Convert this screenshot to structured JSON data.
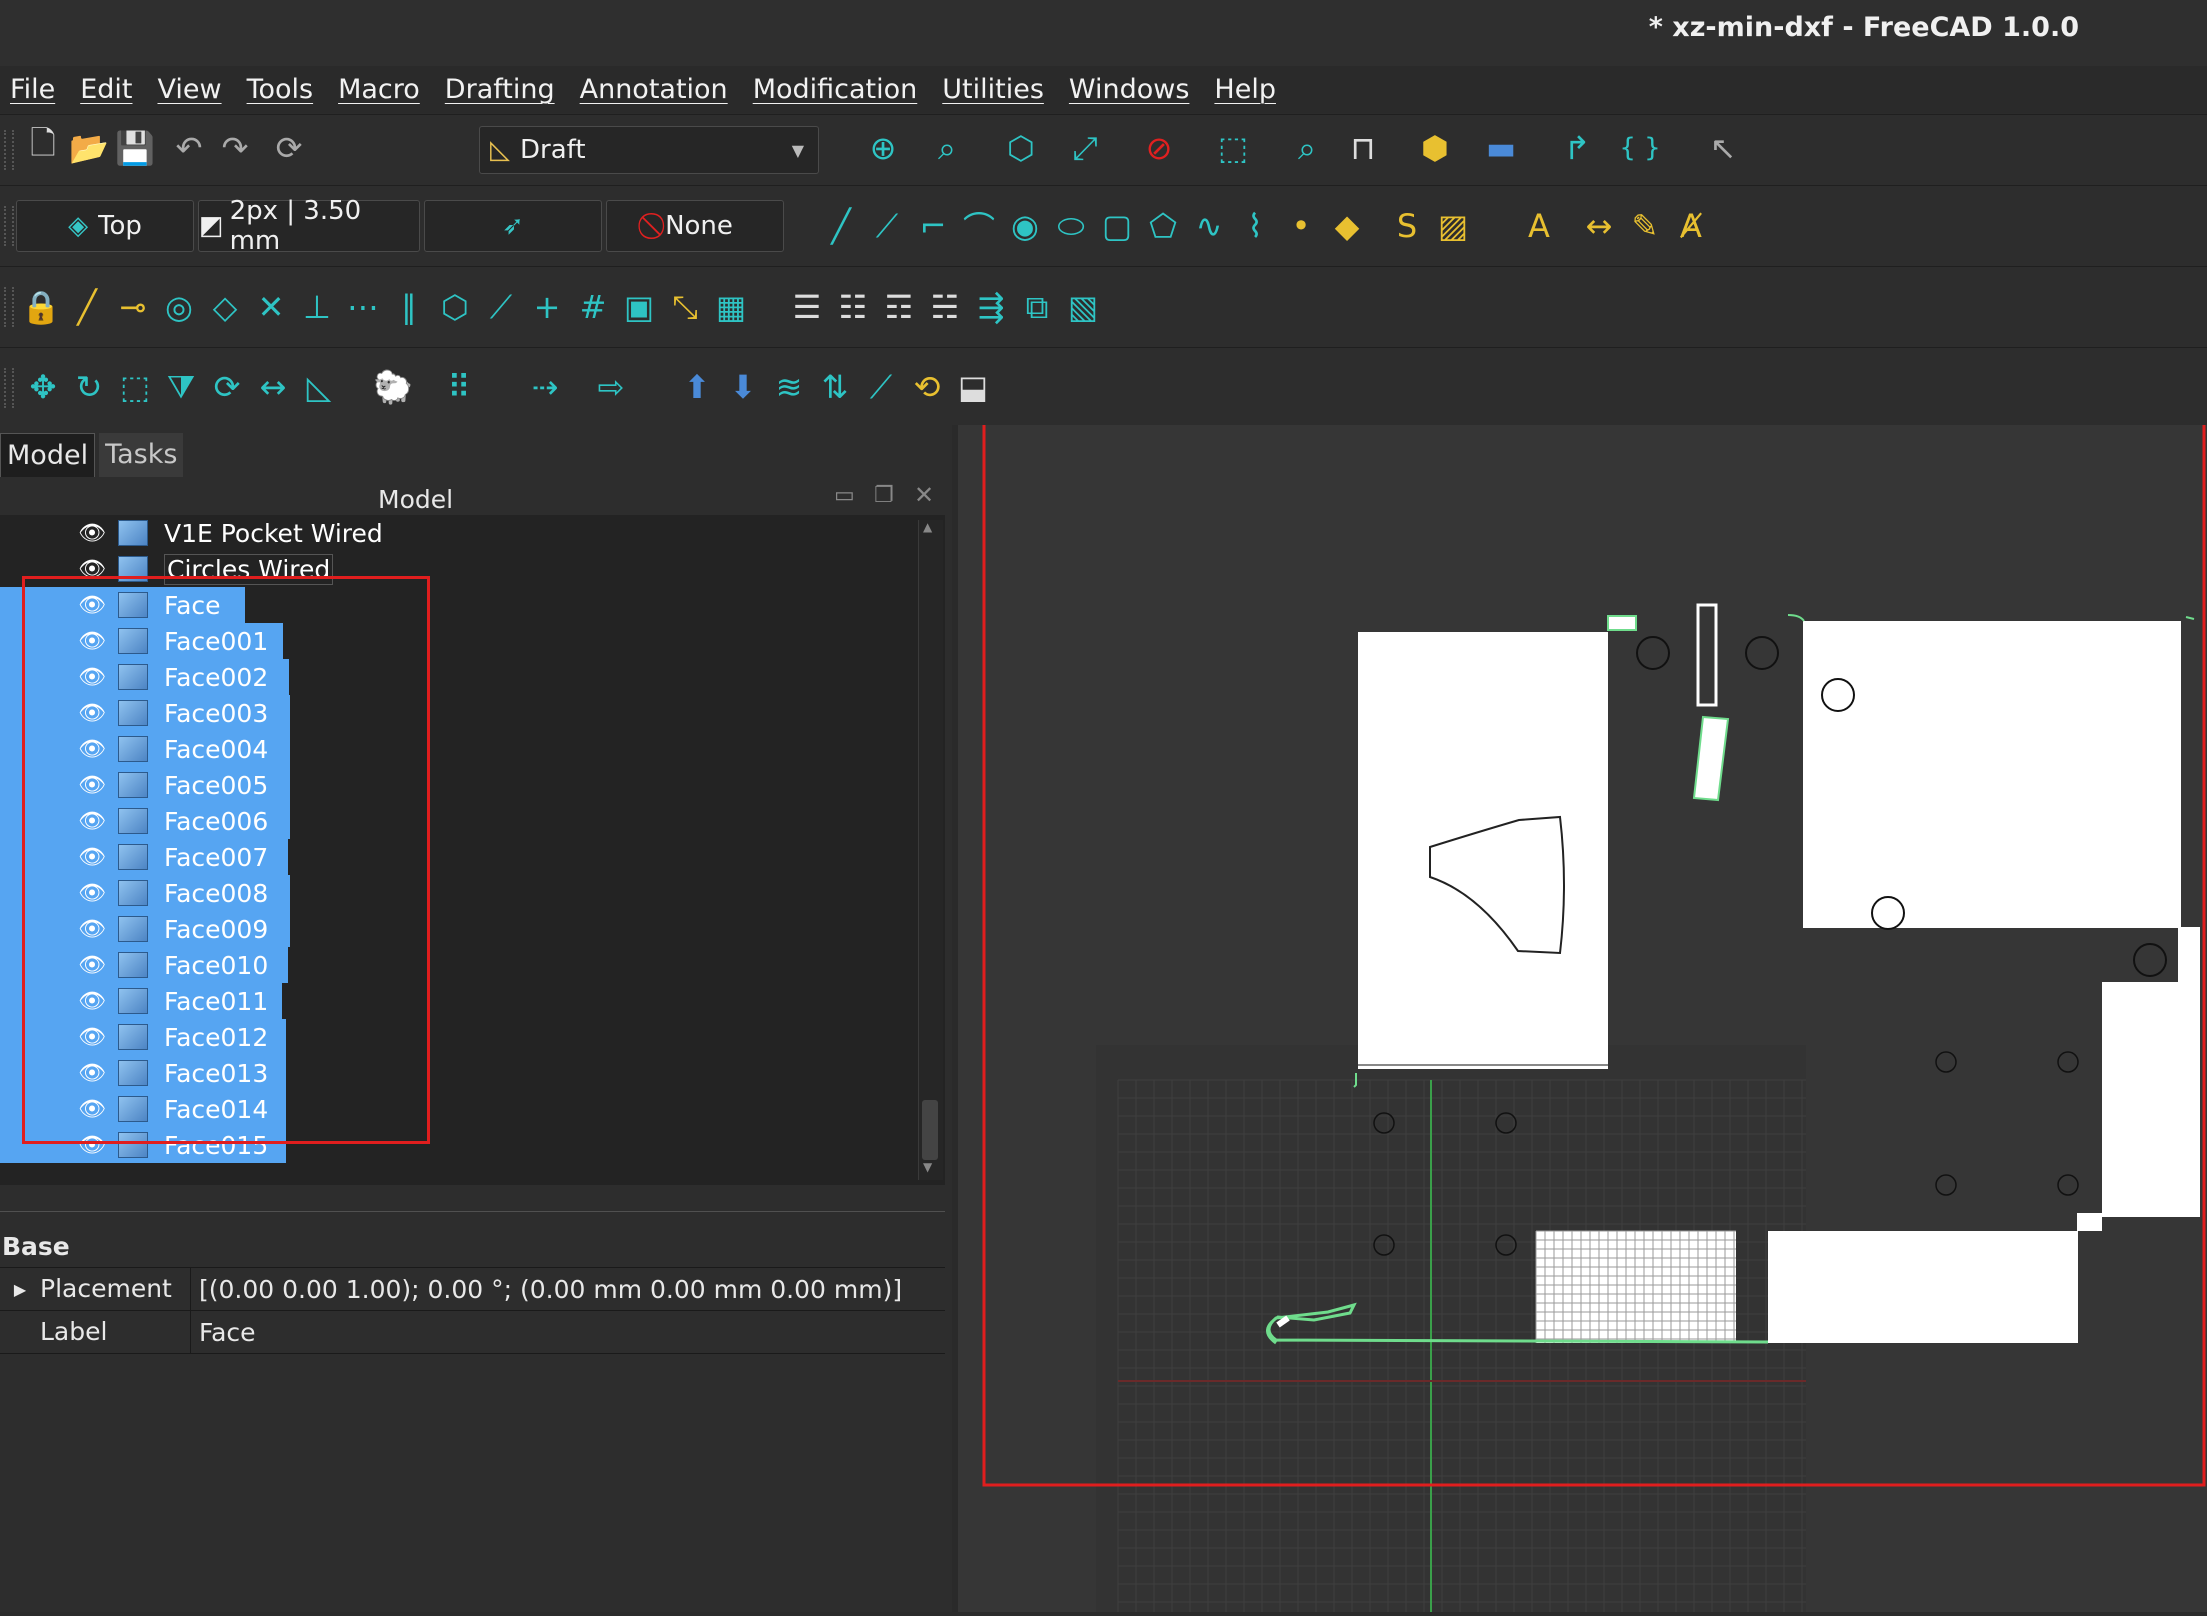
{
  "window": {
    "title": "* xz-min-dxf - FreeCAD 1.0.0"
  },
  "menu": [
    "File",
    "Edit",
    "View",
    "Tools",
    "Macro",
    "Drafting",
    "Annotation",
    "Modification",
    "Utilities",
    "Windows",
    "Help"
  ],
  "toolbar1": {
    "workbench": "Draft"
  },
  "toolbar2": {
    "view": "Top",
    "style": "2px | 3.50 mm",
    "snap_style": "None"
  },
  "panel": {
    "tabs": [
      "Model",
      "Tasks"
    ],
    "tree_header": "Model",
    "tree_items": [
      {
        "label": "V1E Pocket Wired",
        "selected": false
      },
      {
        "label": "Circles Wired",
        "selected": false
      },
      {
        "label": "Face",
        "selected": true
      },
      {
        "label": "Face001",
        "selected": true
      },
      {
        "label": "Face002",
        "selected": true
      },
      {
        "label": "Face003",
        "selected": true
      },
      {
        "label": "Face004",
        "selected": true
      },
      {
        "label": "Face005",
        "selected": true
      },
      {
        "label": "Face006",
        "selected": true
      },
      {
        "label": "Face007",
        "selected": true
      },
      {
        "label": "Face008",
        "selected": true
      },
      {
        "label": "Face009",
        "selected": true
      },
      {
        "label": "Face010",
        "selected": true
      },
      {
        "label": "Face011",
        "selected": true
      },
      {
        "label": "Face012",
        "selected": true
      },
      {
        "label": "Face013",
        "selected": true
      },
      {
        "label": "Face014",
        "selected": true
      },
      {
        "label": "Face015",
        "selected": true
      }
    ],
    "properties": {
      "group": "Base",
      "rows": [
        {
          "name": "Placement",
          "value": "[(0.00 0.00 1.00); 0.00 °; (0.00 mm  0.00 mm  0.00 mm)]"
        },
        {
          "name": "Label",
          "value": "Face"
        }
      ]
    }
  },
  "colors": {
    "selection": "#56a5f2",
    "accent": "#2ec4c4",
    "annotation_red": "#e01e1e"
  },
  "icons": {
    "toolbar1": [
      "new-document-icon",
      "open-icon",
      "save-icon",
      "undo-icon",
      "redo-icon",
      "refresh-icon",
      "fit-all-icon",
      "fit-selection-icon",
      "view-cube-icon",
      "measure-icon",
      "no-draw-icon",
      "box-select-icon",
      "zoom-icon",
      "caliper-icon",
      "part-icon",
      "folder-icon",
      "link-icon",
      "macro-braces-icon",
      "whats-this-icon"
    ],
    "toolbar2": [
      "line-icon",
      "polyline-icon",
      "fillet-icon",
      "arc-icon",
      "circle-icon",
      "ellipse-icon",
      "rectangle-icon",
      "polygon-icon",
      "bspline-icon",
      "bezier-icon",
      "point-icon",
      "facebinder-icon",
      "shapestring-icon",
      "hatch-icon",
      "text-icon",
      "dimension-icon",
      "label-icon",
      "annotation-style-icon"
    ],
    "toolbar3": [
      "snap-lock-icon",
      "snap-endpoint-icon",
      "snap-midpoint-icon",
      "snap-center-icon",
      "snap-angle-icon",
      "snap-intersection-icon",
      "snap-perpendicular-icon",
      "snap-extension-icon",
      "snap-parallel-icon",
      "snap-special-icon",
      "snap-near-icon",
      "snap-ortho-icon",
      "snap-grid-icon",
      "snap-workingplane-icon",
      "snap-dimensions-icon",
      "grid-toggle-icon",
      "layer-icon",
      "tree-icon",
      "tree-add-icon",
      "tree-group-icon",
      "select-group-icon",
      "clone-icon",
      "working-plane-icon"
    ],
    "toolbar4": [
      "move-icon",
      "rotate-icon",
      "scale-icon",
      "mirror-icon",
      "offset-icon",
      "stretch-icon",
      "trimex-icon",
      "clone-sheep-icon",
      "array-icon",
      "join-icon",
      "split-icon",
      "upgrade-icon",
      "downgrade-icon",
      "wire-to-bspline-icon",
      "draft-to-sketch-icon",
      "slope-icon",
      "flip-dimension-icon",
      "shape2dview-icon"
    ]
  }
}
